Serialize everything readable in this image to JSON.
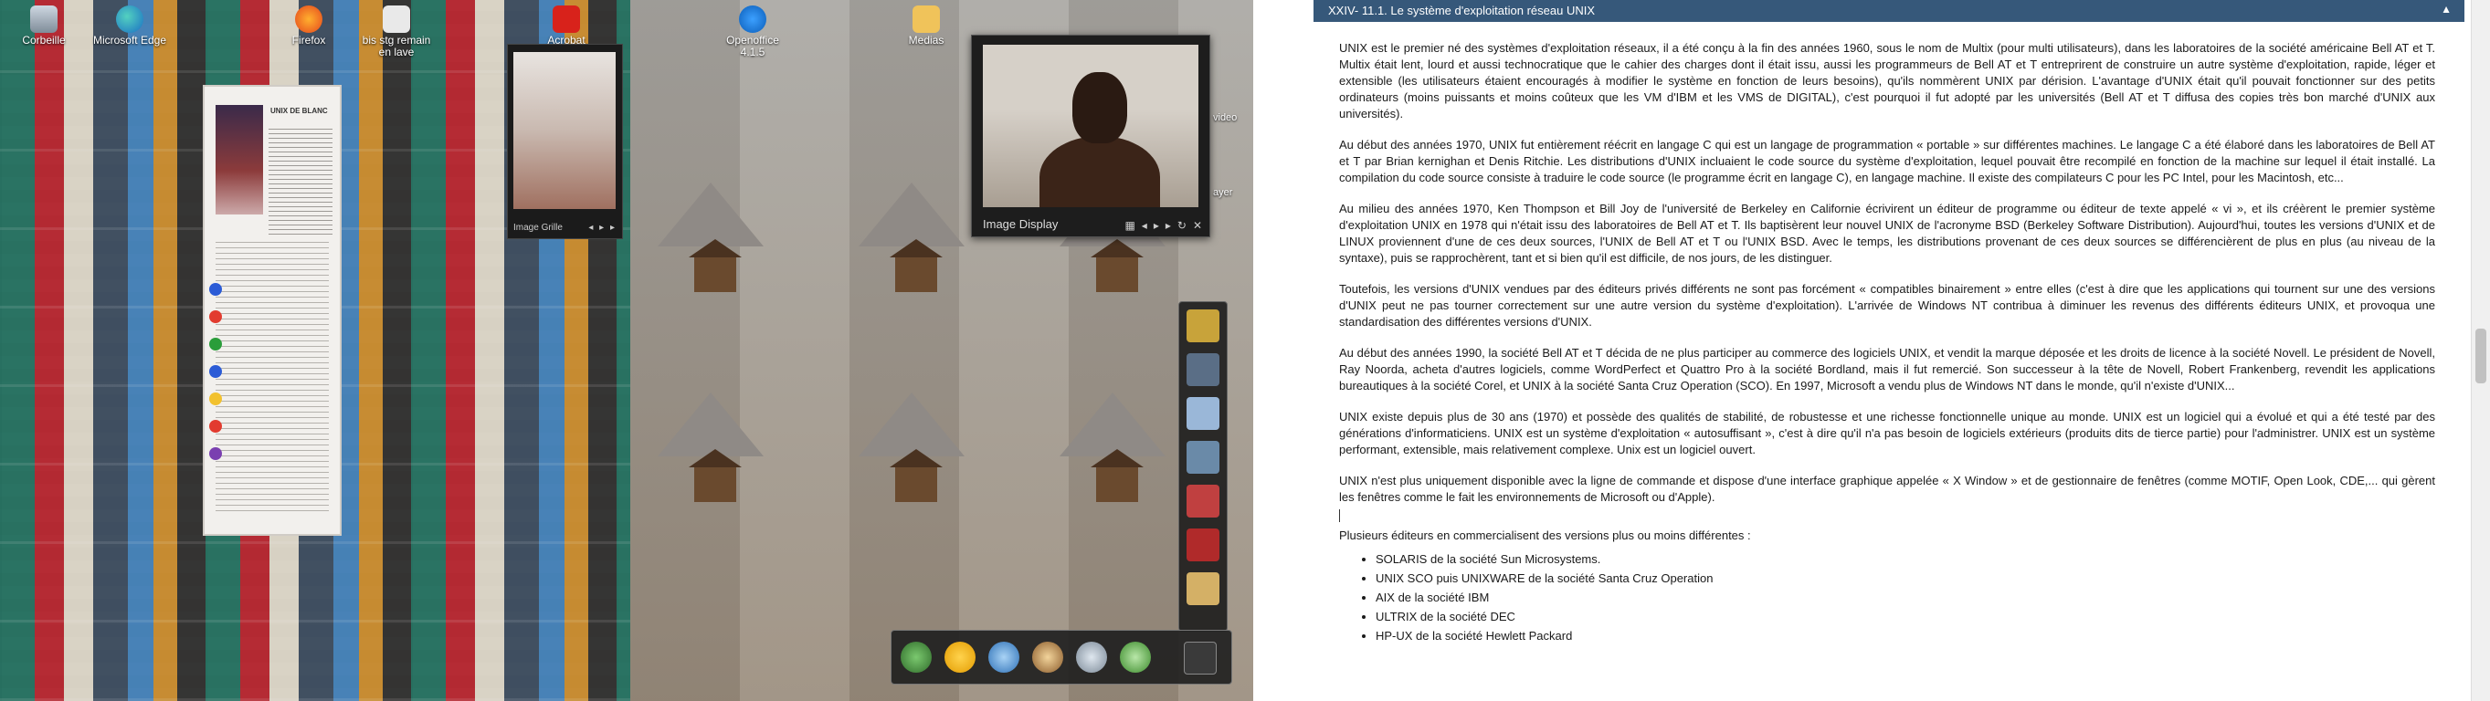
{
  "desktop": {
    "icons": [
      {
        "label": "Corbeille"
      },
      {
        "label": "Microsoft Edge"
      },
      {
        "label": "Firefox"
      },
      {
        "label": "bis stg remain en lave"
      },
      {
        "label": "Acrobat Reader DC"
      },
      {
        "label": "Openoffice 4.1.5"
      },
      {
        "label": "Medias"
      },
      {
        "label": "Image Grille"
      }
    ],
    "edge_labels": {
      "video": "video",
      "player": "ayer"
    },
    "small_viewer_caption": "Image Grille",
    "doc_thumb_heading": "UNIX DE BLANC",
    "image_display": {
      "title": "Image Display"
    },
    "colors": {
      "tray_dot_colors": [
        "#1e7bd8",
        "#2a9d3a",
        "#e23b2f",
        "#f2c12e",
        "#7a3fb0"
      ]
    }
  },
  "document": {
    "section_title": "XXIV- 11.1. Le système d'exploitation réseau UNIX",
    "paragraphs": [
      "UNIX est le premier né des systèmes d'exploitation réseaux, il a été conçu à la fin des années 1960, sous le nom de Multix (pour multi utilisateurs), dans les laboratoires de la société américaine Bell AT et T. Multix était lent, lourd et aussi technocratique que le cahier des charges dont il était issu, aussi les programmeurs de Bell AT et T entreprirent de construire un autre système d'exploitation, rapide, léger et extensible (les utilisateurs étaient encouragés à modifier le système en fonction de leurs besoins), qu'ils nommèrent UNIX par dérision. L'avantage d'UNIX était qu'il pouvait fonctionner sur des petits ordinateurs (moins puissants et moins coûteux que les VM d'IBM et les VMS de DIGITAL), c'est pourquoi il fut adopté par les universités (Bell AT et T diffusa des copies très bon marché d'UNIX aux universités).",
      "Au début des années 1970, UNIX fut entièrement réécrit en langage C qui est un langage de programmation « portable » sur différentes machines. Le langage C a été élaboré dans les laboratoires de Bell AT et T par Brian kernighan et Denis Ritchie. Les distributions d'UNIX incluaient le code source du système d'exploitation, lequel pouvait être recompilé en fonction de la machine sur lequel il était installé. La compilation du code source consiste à traduire le code source (le programme écrit en langage C), en langage machine. Il existe des compilateurs C pour les PC Intel, pour les Macintosh, etc...",
      "Au milieu des années 1970, Ken Thompson et Bill Joy de l'université de Berkeley en Californie écrivirent un éditeur de programme ou éditeur de texte appelé « vi », et ils créèrent le premier système d'exploitation UNIX en 1978 qui n'était issu des laboratoires de Bell AT et T. Ils baptisèrent leur nouvel UNIX de l'acronyme BSD (Berkeley Software Distribution). Aujourd'hui, toutes les versions d'UNIX et de LINUX proviennent d'une de ces deux sources, l'UNIX de Bell AT et T ou l'UNIX BSD. Avec le temps, les distributions provenant de ces deux sources se différencièrent de plus en plus (au niveau de la syntaxe), puis se rapprochèrent, tant et si bien qu'il est difficile, de nos jours, de les distinguer.",
      "Toutefois, les versions d'UNIX vendues par des éditeurs privés différents ne sont pas forcément « compatibles binairement » entre elles (c'est à dire que les applications qui tournent sur une des versions d'UNIX peut ne pas tourner correctement sur une autre version du système d'exploitation). L'arrivée de Windows NT contribua à diminuer les revenus des différents éditeurs UNIX, et provoqua une standardisation des différentes versions d'UNIX.",
      "Au début des années 1990, la société Bell AT et T décida de ne plus participer au commerce des logiciels UNIX, et vendit la marque déposée et les droits de licence à la société Novell. Le président de Novell, Ray Noorda, acheta d'autres logiciels, comme WordPerfect et Quattro Pro à la société Bordland, mais il fut remercié. Son successeur à la tête de Novell, Robert Frankenberg, revendit les applications bureautiques à la société Corel, et UNIX à la société Santa Cruz Operation (SCO). En 1997, Microsoft a vendu plus de Windows NT dans le monde, qu'il n'existe d'UNIX...",
      "UNIX existe depuis plus de 30 ans (1970) et possède des qualités de stabilité, de robustesse et une richesse fonctionnelle unique au monde. UNIX est un logiciel qui a évolué et qui a été testé par des générations d'informaticiens. UNIX est un système d'exploitation « autosuffisant », c'est à dire qu'il n'a pas besoin de logiciels extérieurs (produits dits de tierce partie) pour l'administrer. UNIX est un système performant, extensible, mais relativement complexe. Unix est un logiciel ouvert.",
      "UNIX n'est plus uniquement disponible avec la ligne de commande et dispose d'une interface graphique appelée « X Window » et de gestionnaire de fenêtres (comme MOTIF, Open Look, CDE,... qui gèrent les fenêtres comme le fait les environnements de Microsoft ou d'Apple)."
    ],
    "list_intro": "Plusieurs éditeurs en commercialisent des versions plus ou moins différentes :",
    "list_items": [
      "SOLARIS de la société Sun Microsystems.",
      "UNIX SCO puis UNIXWARE de la société Santa Cruz Operation",
      "AIX de la société IBM",
      "ULTRIX de la société DEC",
      "HP-UX de la société Hewlett Packard"
    ]
  }
}
